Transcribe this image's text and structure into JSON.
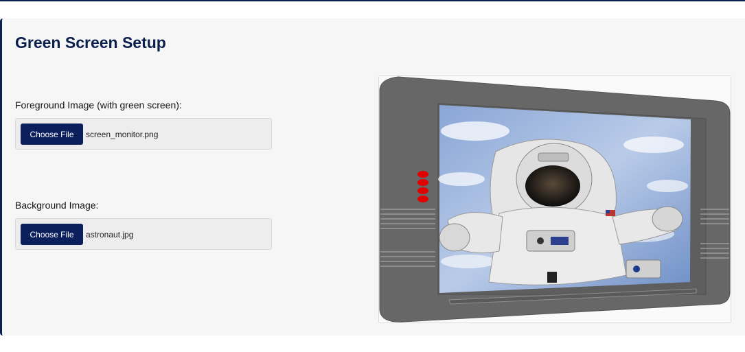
{
  "page": {
    "title": "Green Screen Setup"
  },
  "foreground": {
    "label": "Foreground Image (with green screen):",
    "button_label": "Choose File",
    "file_name": "screen_monitor.png"
  },
  "background": {
    "label": "Background Image:",
    "button_label": "Choose File",
    "file_name": "astronaut.jpg"
  },
  "preview": {
    "content": "monitor with astronaut composited on screen",
    "icons": [
      "monitor-frame-icon",
      "astronaut-image"
    ]
  },
  "colors": {
    "accent": "#0b1f4d",
    "button": "#0b1f5c",
    "monitor_body": "#6b6b6b",
    "indicator_leds": "#e00000"
  }
}
